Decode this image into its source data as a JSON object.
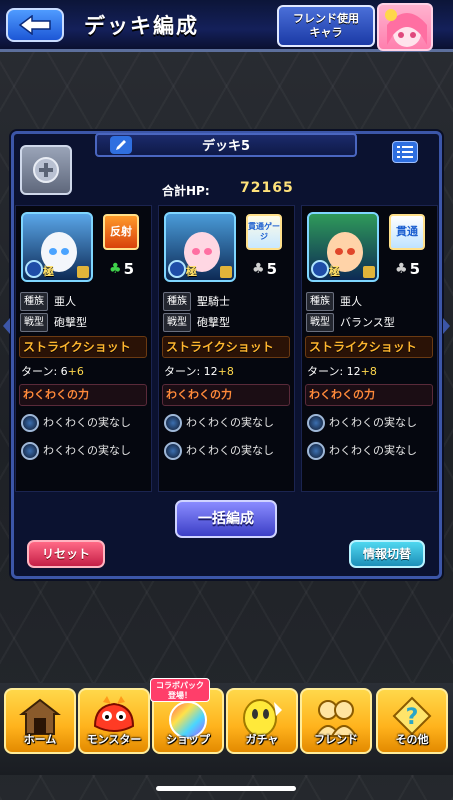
{
  "header": {
    "title": "デッキ編成",
    "friend_button_line1": "フレンド使用",
    "friend_button_line2": "キャラ"
  },
  "deck": {
    "name": "デッキ5",
    "total_hp_label": "合計HP:",
    "total_hp_value": "72165"
  },
  "characters": [
    {
      "rank": "極",
      "ability": "反射",
      "luck": "5",
      "tribe_label": "種族",
      "tribe": "亜人",
      "type_label": "戦型",
      "type": "砲撃型",
      "strike_shot_label": "ストライクショット",
      "turn_label": "ターン: 6",
      "turn_bonus": "+6",
      "waku_title": "わくわくの力",
      "waku_slots": [
        "わくわくの実なし",
        "わくわくの実なし"
      ],
      "colors": {
        "bg": "#5aa6e8",
        "face": "#f3f6fb",
        "eye": "#4aa3ff"
      }
    },
    {
      "rank": "極",
      "ability": "貫通ゲージ",
      "luck": "5",
      "tribe_label": "種族",
      "tribe": "聖騎士",
      "type_label": "戦型",
      "type": "砲撃型",
      "strike_shot_label": "ストライクショット",
      "turn_label": "ターン: 12",
      "turn_bonus": "+8",
      "waku_title": "わくわくの力",
      "waku_slots": [
        "わくわくの実なし",
        "わくわくの実なし"
      ],
      "colors": {
        "bg": "#4a9bd8",
        "face": "#ffd7e3",
        "eye": "#ff6fa2"
      }
    },
    {
      "rank": "極",
      "ability": "貫通",
      "luck": "5",
      "tribe_label": "種族",
      "tribe": "亜人",
      "type_label": "戦型",
      "type": "バランス型",
      "strike_shot_label": "ストライクショット",
      "turn_label": "ターン: 12",
      "turn_bonus": "+8",
      "waku_title": "わくわくの力",
      "waku_slots": [
        "わくわくの実なし",
        "わくわくの実なし"
      ],
      "colors": {
        "bg": "#2f9a5a",
        "face": "#ffd3a8",
        "eye": "#e0462a"
      }
    }
  ],
  "actions": {
    "bulk_edit": "一括編成",
    "reset": "リセット",
    "info_toggle": "情報切替"
  },
  "nav": {
    "collab_badge_line1": "コラボパック",
    "collab_badge_line2": "登場！",
    "items": [
      {
        "label": "ホーム",
        "icon": "home-icon"
      },
      {
        "label": "モンスター",
        "icon": "monster-icon"
      },
      {
        "label": "ショップ",
        "icon": "shop-icon"
      },
      {
        "label": "ガチャ",
        "icon": "gacha-icon"
      },
      {
        "label": "フレンド",
        "icon": "friend-icon"
      },
      {
        "label": "その他",
        "icon": "other-icon"
      }
    ]
  },
  "colors": {
    "accent_blue": "#3c56a8",
    "gold": "#ffb21c",
    "strike_shot": "#ffb62f"
  }
}
